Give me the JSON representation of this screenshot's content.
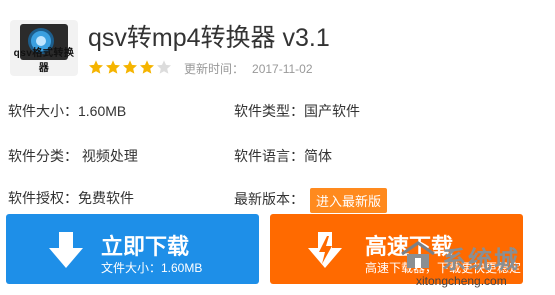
{
  "app": {
    "title": "qsv转mp4转换器 v3.1",
    "icon_brand": "qsv格式转换器",
    "rating_stars": 4,
    "rating_max": 5
  },
  "update": {
    "label": "更新时间：",
    "date": "2017-11-02"
  },
  "info": {
    "size": "软件大小：1.60MB",
    "type": "软件类型：国产软件",
    "category": "软件分类： 视频处理",
    "language": "软件语言：简体",
    "license": "软件授权：免费软件",
    "latest_label": "最新版本：",
    "latest_button": "进入最新版"
  },
  "buttons": {
    "download": {
      "label": "立即下载",
      "sub": "文件大小：1.60MB"
    },
    "fast_download": {
      "label": "高速下载",
      "sub": "高速下载器，下载更快更稳定"
    }
  },
  "watermark": {
    "text": "系统城",
    "url": "xitongcheng.com"
  },
  "colors": {
    "blue": "#1e8fe8",
    "orange": "#ff6a00",
    "badge": "#ff8a1e",
    "star": "#f5b400"
  }
}
